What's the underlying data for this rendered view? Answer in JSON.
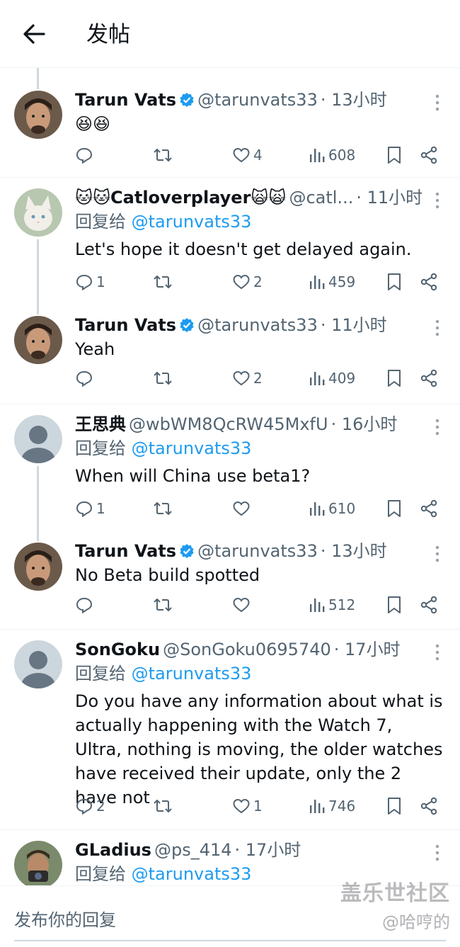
{
  "header": {
    "title": "发帖"
  },
  "posts": [
    {
      "name": "Tarun Vats",
      "handle": "@tarunvats33",
      "time": "· 13小时",
      "text": "😆😆",
      "reply": "",
      "retweet": "",
      "like": "4",
      "views": "608"
    },
    {
      "name": "🐱🐱Catloverplayer🙀🙀",
      "handle": "@catl...",
      "time": "· 11小时",
      "reply_label": "回复给",
      "reply_mention": "@tarunvats33",
      "text": "Let's hope it doesn't get delayed again.",
      "reply": "1",
      "retweet": "",
      "like": "2",
      "views": "459"
    },
    {
      "name": "Tarun Vats",
      "handle": "@tarunvats33",
      "time": "· 11小时",
      "text": "Yeah",
      "reply": "",
      "retweet": "",
      "like": "2",
      "views": "409"
    },
    {
      "name": "王思典",
      "handle": "@wbWM8QcRW45MxfU",
      "time": "· 16小时",
      "reply_label": "回复给",
      "reply_mention": "@tarunvats33",
      "text": "When will China use beta1?",
      "reply": "1",
      "retweet": "",
      "like": "",
      "views": "610"
    },
    {
      "name": "Tarun Vats",
      "handle": "@tarunvats33",
      "time": "· 13小时",
      "text": "No Beta build spotted",
      "reply": "",
      "retweet": "",
      "like": "",
      "views": "512"
    },
    {
      "name": "SonGoku",
      "handle": "@SonGoku0695740",
      "time": "· 17小时",
      "reply_label": "回复给",
      "reply_mention": "@tarunvats33",
      "text": "Do you have any information about what is actually happening with the Watch 7, Ultra, nothing is moving, the older watches have received their update, only the 2 have not",
      "reply": "2",
      "retweet": "",
      "like": "1",
      "views": "746"
    },
    {
      "name": "GLadius",
      "handle": "@ps_414",
      "time": "· 17小时",
      "reply_label": "回复给",
      "reply_mention": "@tarunvats33"
    }
  ],
  "reply_bar": {
    "placeholder": "发布你的回复"
  },
  "watermark": {
    "brand": "盖乐世社区",
    "user": "@哈哼的"
  },
  "colors": {
    "accent": "#1d9bf0",
    "secondary_text": "#536471",
    "thread_line": "#cfd9de",
    "verified": "#1d9bf0"
  }
}
